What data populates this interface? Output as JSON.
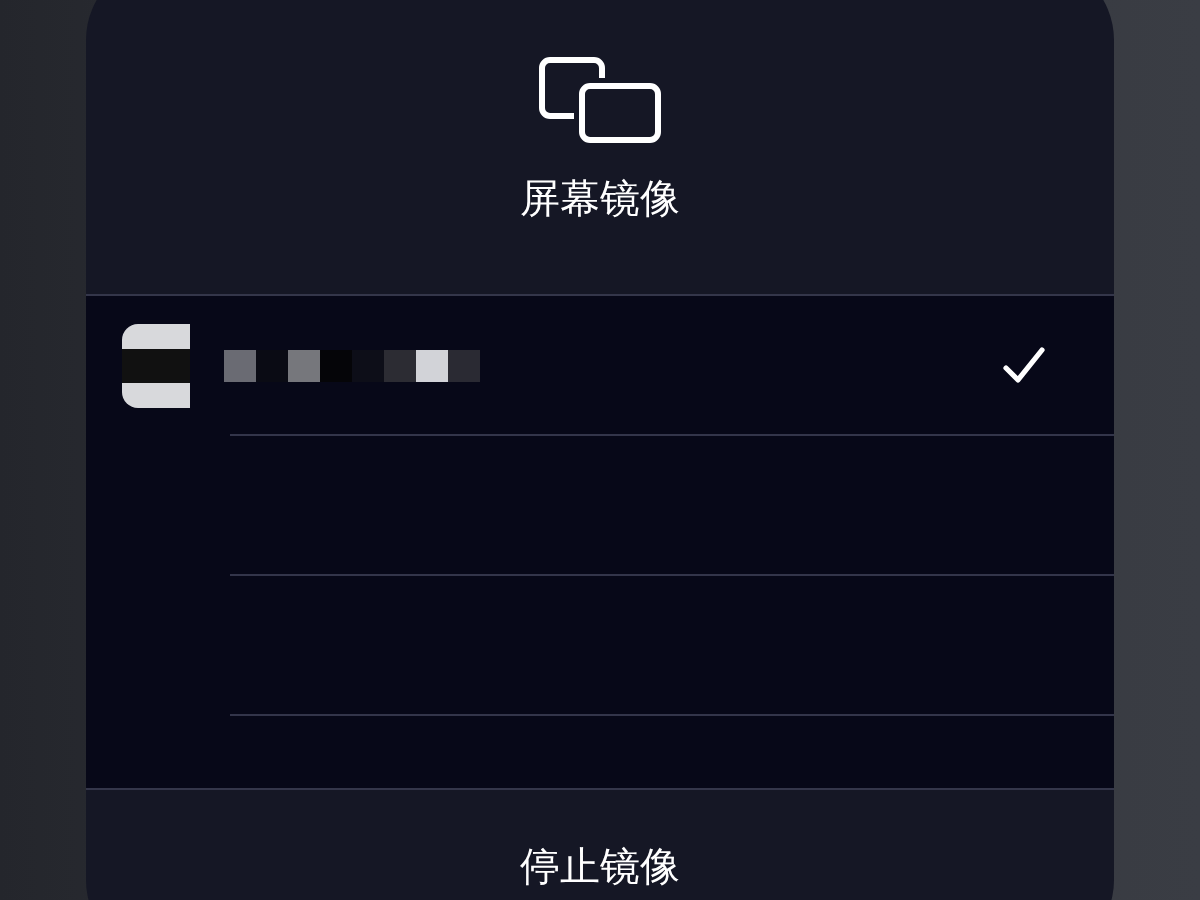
{
  "panel": {
    "title": "屏幕镜像"
  },
  "devices": [
    {
      "selected": true
    },
    {
      "selected": false
    },
    {
      "selected": false
    }
  ],
  "footer": {
    "button": "停止镜像"
  }
}
